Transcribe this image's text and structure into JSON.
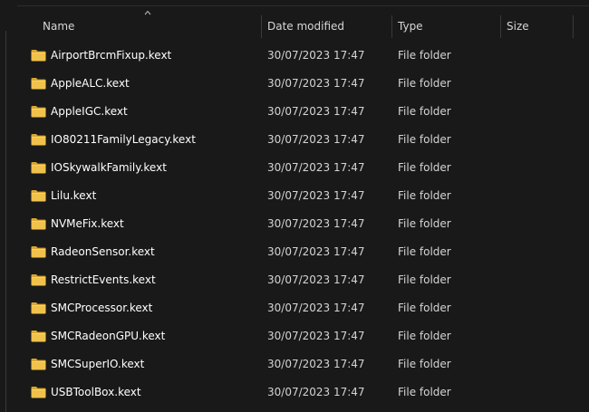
{
  "columns": {
    "name": "Name",
    "date_modified": "Date modified",
    "type": "Type",
    "size": "Size"
  },
  "sort": {
    "column": "name",
    "direction": "ascending"
  },
  "icons": {
    "folder": "folder-icon",
    "sort": "sort-ascending-icon"
  },
  "colors": {
    "background": "#191919",
    "folder": "#f0c24b"
  },
  "rows": [
    {
      "name": "AirportBrcmFixup.kext",
      "date": "30/07/2023 17:47",
      "type": "File folder",
      "size": ""
    },
    {
      "name": "AppleALC.kext",
      "date": "30/07/2023 17:47",
      "type": "File folder",
      "size": ""
    },
    {
      "name": "AppleIGC.kext",
      "date": "30/07/2023 17:47",
      "type": "File folder",
      "size": ""
    },
    {
      "name": "IO80211FamilyLegacy.kext",
      "date": "30/07/2023 17:47",
      "type": "File folder",
      "size": ""
    },
    {
      "name": "IOSkywalkFamily.kext",
      "date": "30/07/2023 17:47",
      "type": "File folder",
      "size": ""
    },
    {
      "name": "Lilu.kext",
      "date": "30/07/2023 17:47",
      "type": "File folder",
      "size": ""
    },
    {
      "name": "NVMeFix.kext",
      "date": "30/07/2023 17:47",
      "type": "File folder",
      "size": ""
    },
    {
      "name": "RadeonSensor.kext",
      "date": "30/07/2023 17:47",
      "type": "File folder",
      "size": ""
    },
    {
      "name": "RestrictEvents.kext",
      "date": "30/07/2023 17:47",
      "type": "File folder",
      "size": ""
    },
    {
      "name": "SMCProcessor.kext",
      "date": "30/07/2023 17:47",
      "type": "File folder",
      "size": ""
    },
    {
      "name": "SMCRadeonGPU.kext",
      "date": "30/07/2023 17:47",
      "type": "File folder",
      "size": ""
    },
    {
      "name": "SMCSuperIO.kext",
      "date": "30/07/2023 17:47",
      "type": "File folder",
      "size": ""
    },
    {
      "name": "USBToolBox.kext",
      "date": "30/07/2023 17:47",
      "type": "File folder",
      "size": ""
    }
  ]
}
